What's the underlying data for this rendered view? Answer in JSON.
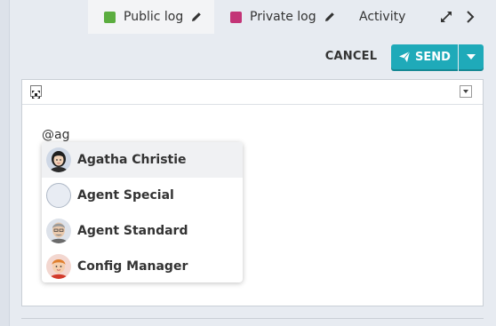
{
  "tabs": [
    {
      "label": "Public log",
      "color": "#5bad3f"
    },
    {
      "label": "Private log",
      "color": "#c33477"
    },
    {
      "label": "Activity"
    }
  ],
  "toolbar": {
    "cancel_label": "CANCEL",
    "send_label": "SEND"
  },
  "editor": {
    "text": "@ag"
  },
  "mentions": [
    {
      "name": "Agatha Christie"
    },
    {
      "name": "Agent Special"
    },
    {
      "name": "Agent Standard"
    },
    {
      "name": "Config Manager"
    }
  ],
  "colors": {
    "accent": "#1faab9"
  }
}
